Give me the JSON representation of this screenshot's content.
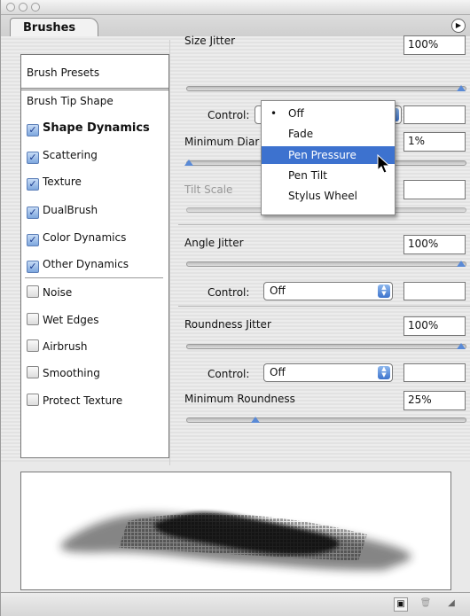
{
  "panel": {
    "tab_label": "Brushes",
    "menu_icon": "triangle-right-icon"
  },
  "sidebar": {
    "presets_label": "Brush Presets",
    "tip_shape_label": "Brush Tip Shape",
    "items": [
      {
        "label": "Shape Dynamics",
        "checked": true,
        "selected": true
      },
      {
        "label": "Scattering",
        "checked": true
      },
      {
        "label": "Texture",
        "checked": true
      },
      {
        "label": "DualBrush",
        "checked": true
      },
      {
        "label": "Color Dynamics",
        "checked": true
      },
      {
        "label": "Other Dynamics",
        "checked": true
      },
      {
        "label": "Noise",
        "checked": false
      },
      {
        "label": "Wet Edges",
        "checked": false
      },
      {
        "label": "Airbrush",
        "checked": false
      },
      {
        "label": "Smoothing",
        "checked": false
      },
      {
        "label": "Protect Texture",
        "checked": false
      }
    ]
  },
  "settings": {
    "size_jitter": {
      "label": "Size Jitter",
      "value": "100%",
      "level": 1.0
    },
    "size_control": {
      "label": "Control:"
    },
    "minimum_diameter": {
      "label": "Minimum Diar",
      "value": "1%",
      "level": 0.01
    },
    "tilt_scale": {
      "label": "Tilt Scale",
      "value": ""
    },
    "angle_jitter": {
      "label": "Angle Jitter",
      "value": "100%",
      "level": 1.0
    },
    "angle_control": {
      "label": "Control:",
      "value": "Off"
    },
    "roundness_jitter": {
      "label": "Roundness Jitter",
      "value": "100%",
      "level": 1.0
    },
    "roundness_control": {
      "label": "Control:",
      "value": "Off"
    },
    "minimum_roundness": {
      "label": "Minimum Roundness",
      "value": "25%",
      "level": 0.25
    }
  },
  "control_menu": {
    "items": [
      {
        "label": "Off",
        "checked": true
      },
      {
        "label": "Fade"
      },
      {
        "label": "Pen Pressure",
        "highlighted": true
      },
      {
        "label": "Pen Tilt"
      },
      {
        "label": "Stylus Wheel"
      }
    ]
  },
  "footer": {
    "new_icon": "new-brush-icon",
    "delete_icon": "trash-icon",
    "resize_icon": "resize-grip-icon"
  },
  "colors": {
    "highlight": "#3d72cf",
    "slider_thumb": "#5a8ad6",
    "checkbox_on": "#7ea7de"
  }
}
